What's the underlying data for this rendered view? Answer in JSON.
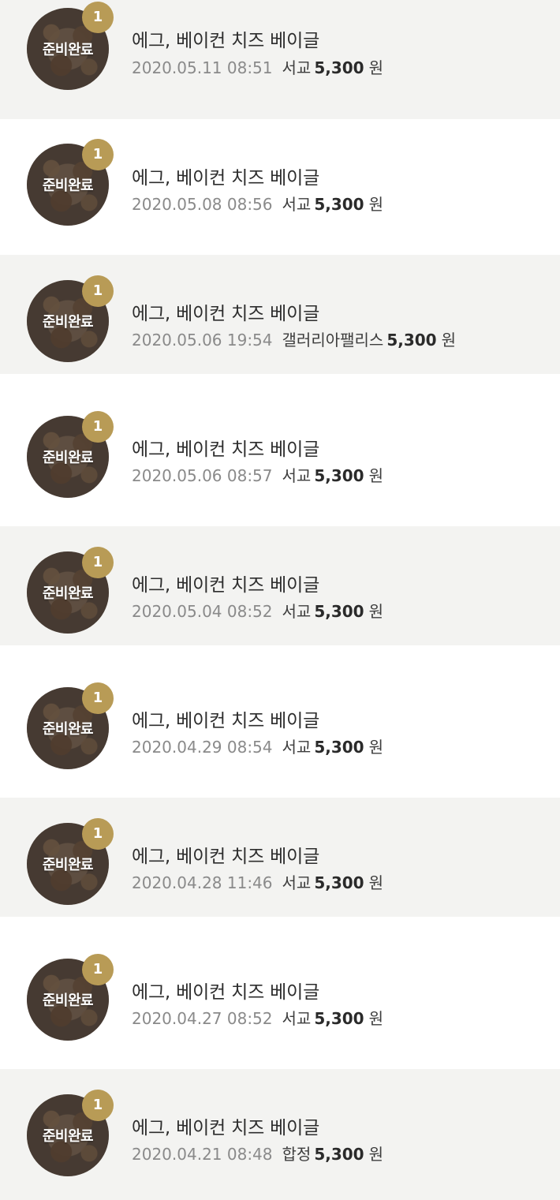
{
  "orders": [
    {
      "status": "준비완료",
      "quantity": "1",
      "item_name": "에그, 베이컨 치즈 베이글",
      "datetime": "2020.05.11 08:51",
      "store": "서교",
      "price": "5,300",
      "currency": "원"
    },
    {
      "status": "준비완료",
      "quantity": "1",
      "item_name": "에그, 베이컨 치즈 베이글",
      "datetime": "2020.05.08 08:56",
      "store": "서교",
      "price": "5,300",
      "currency": "원"
    },
    {
      "status": "준비완료",
      "quantity": "1",
      "item_name": "에그, 베이컨 치즈 베이글",
      "datetime": "2020.05.06 19:54",
      "store": "갤러리아팰리스",
      "price": "5,300",
      "currency": "원"
    },
    {
      "status": "준비완료",
      "quantity": "1",
      "item_name": "에그, 베이컨 치즈 베이글",
      "datetime": "2020.05.06 08:57",
      "store": "서교",
      "price": "5,300",
      "currency": "원"
    },
    {
      "status": "준비완료",
      "quantity": "1",
      "item_name": "에그, 베이컨 치즈 베이글",
      "datetime": "2020.05.04 08:52",
      "store": "서교",
      "price": "5,300",
      "currency": "원"
    },
    {
      "status": "준비완료",
      "quantity": "1",
      "item_name": "에그, 베이컨 치즈 베이글",
      "datetime": "2020.04.29 08:54",
      "store": "서교",
      "price": "5,300",
      "currency": "원"
    },
    {
      "status": "준비완료",
      "quantity": "1",
      "item_name": "에그, 베이컨 치즈 베이글",
      "datetime": "2020.04.28 11:46",
      "store": "서교",
      "price": "5,300",
      "currency": "원"
    },
    {
      "status": "준비완료",
      "quantity": "1",
      "item_name": "에그, 베이컨 치즈 베이글",
      "datetime": "2020.04.27 08:52",
      "store": "서교",
      "price": "5,300",
      "currency": "원"
    },
    {
      "status": "준비완료",
      "quantity": "1",
      "item_name": "에그, 베이컨 치즈 베이글",
      "datetime": "2020.04.21 08:48",
      "store": "합정",
      "price": "5,300",
      "currency": "원"
    }
  ]
}
